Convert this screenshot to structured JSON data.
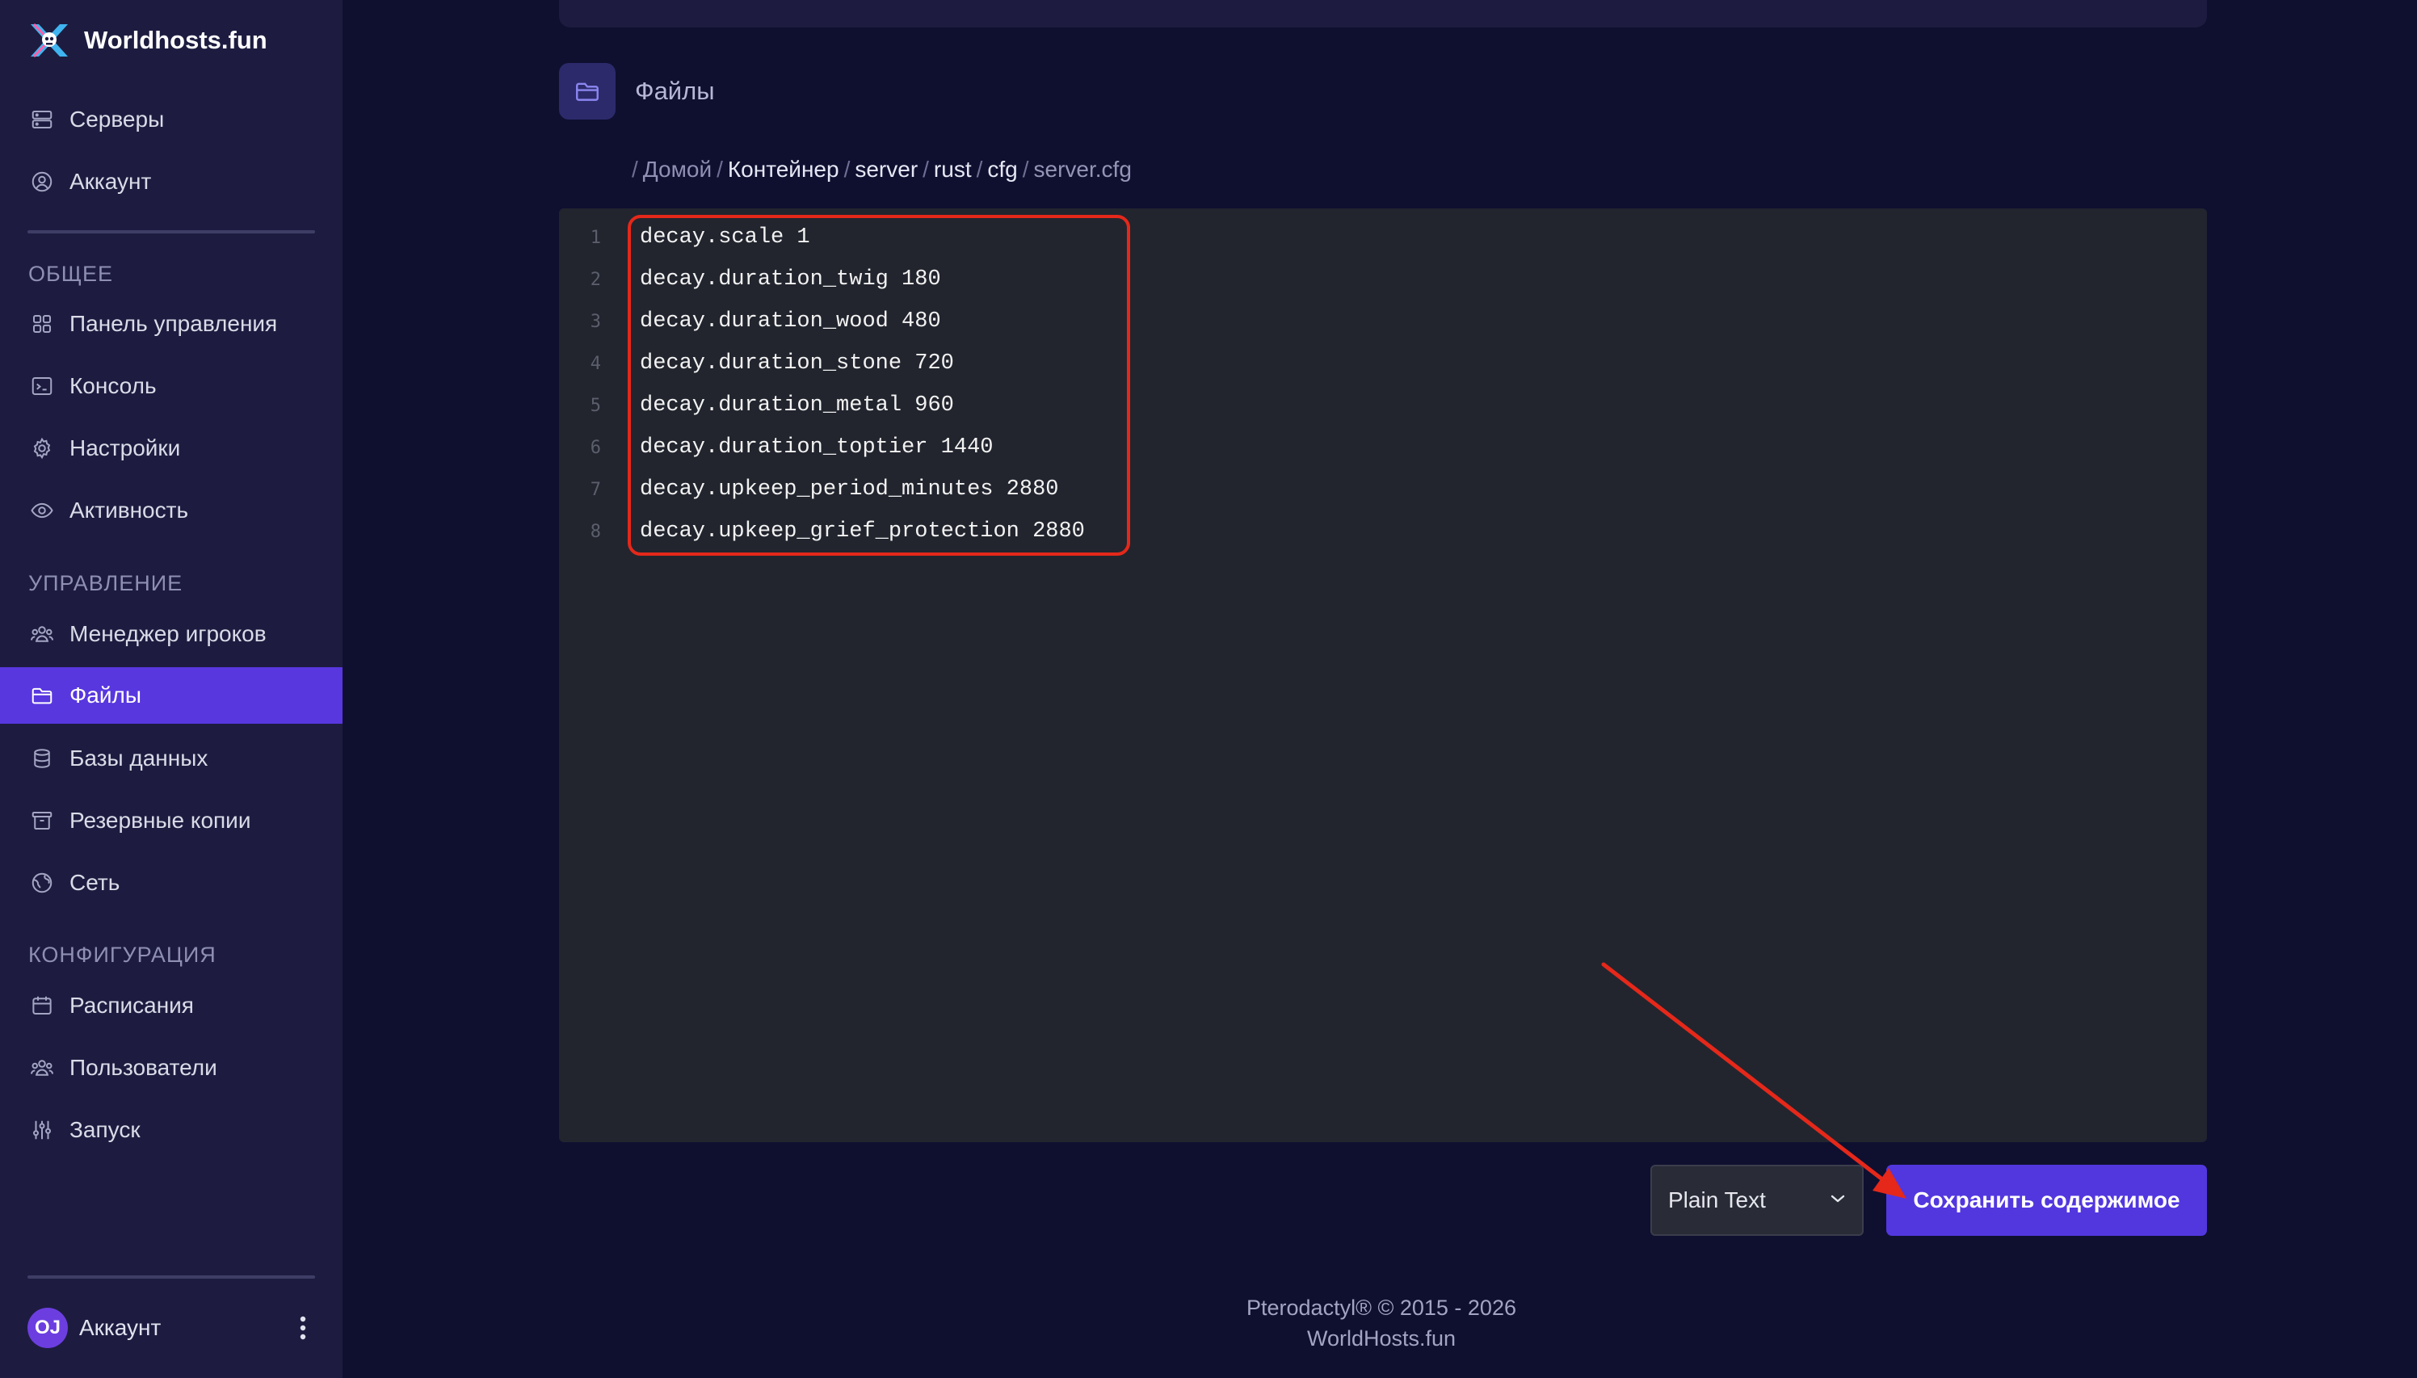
{
  "brand": {
    "name": "Worldhosts.fun",
    "logo_icon": "worldhosts-logo-icon"
  },
  "sidebar": {
    "top_items": [
      {
        "label": "Серверы",
        "icon": "server-icon"
      },
      {
        "label": "Аккаунт",
        "icon": "user-circle-icon"
      }
    ],
    "sections": [
      {
        "title": "ОБЩЕЕ",
        "items": [
          {
            "label": "Панель управления",
            "icon": "dashboard-grid-icon"
          },
          {
            "label": "Консоль",
            "icon": "terminal-icon"
          },
          {
            "label": "Настройки",
            "icon": "gear-icon"
          },
          {
            "label": "Активность",
            "icon": "eye-icon"
          }
        ]
      },
      {
        "title": "УПРАВЛЕНИЕ",
        "items": [
          {
            "label": "Менеджер игроков",
            "icon": "users-icon"
          },
          {
            "label": "Файлы",
            "icon": "folder-icon",
            "active": true
          },
          {
            "label": "Базы данных",
            "icon": "database-icon"
          },
          {
            "label": "Резервные копии",
            "icon": "archive-icon"
          },
          {
            "label": "Сеть",
            "icon": "globe-icon"
          }
        ]
      },
      {
        "title": "КОНФИГУРАЦИЯ",
        "items": [
          {
            "label": "Расписания",
            "icon": "calendar-icon"
          },
          {
            "label": "Пользователи",
            "icon": "users-icon"
          },
          {
            "label": "Запуск",
            "icon": "sliders-icon"
          }
        ]
      }
    ],
    "account": {
      "initials": "OJ",
      "label": "Аккаунт",
      "menu_icon": "kebab-menu-icon"
    }
  },
  "page": {
    "title": "Файлы",
    "title_icon": "folder-open-icon"
  },
  "breadcrumb": {
    "items": [
      "Домой",
      "Контейнер",
      "server",
      "rust",
      "cfg",
      "server.cfg"
    ]
  },
  "editor": {
    "lines": [
      {
        "no": "1",
        "text": "decay.scale 1"
      },
      {
        "no": "2",
        "text": "decay.duration_twig 180"
      },
      {
        "no": "3",
        "text": "decay.duration_wood 480"
      },
      {
        "no": "4",
        "text": "decay.duration_stone 720"
      },
      {
        "no": "5",
        "text": "decay.duration_metal 960"
      },
      {
        "no": "6",
        "text": "decay.duration_toptier 1440"
      },
      {
        "no": "7",
        "text": "decay.upkeep_period_minutes 2880"
      },
      {
        "no": "8",
        "text": "decay.upkeep_grief_protection 2880"
      }
    ]
  },
  "actions": {
    "language_select": "Plain Text",
    "save_label": "Сохранить содержимое"
  },
  "annotations": {
    "color": "#e5281a"
  },
  "footer": {
    "line1": "Pterodactyl® © 2015 - 2026",
    "line2": "WorldHosts.fun"
  },
  "colors": {
    "accent": "#5237df",
    "sidebar_bg": "#1d1c40",
    "page_bg": "#0f1030",
    "editor_bg": "#22252e"
  }
}
